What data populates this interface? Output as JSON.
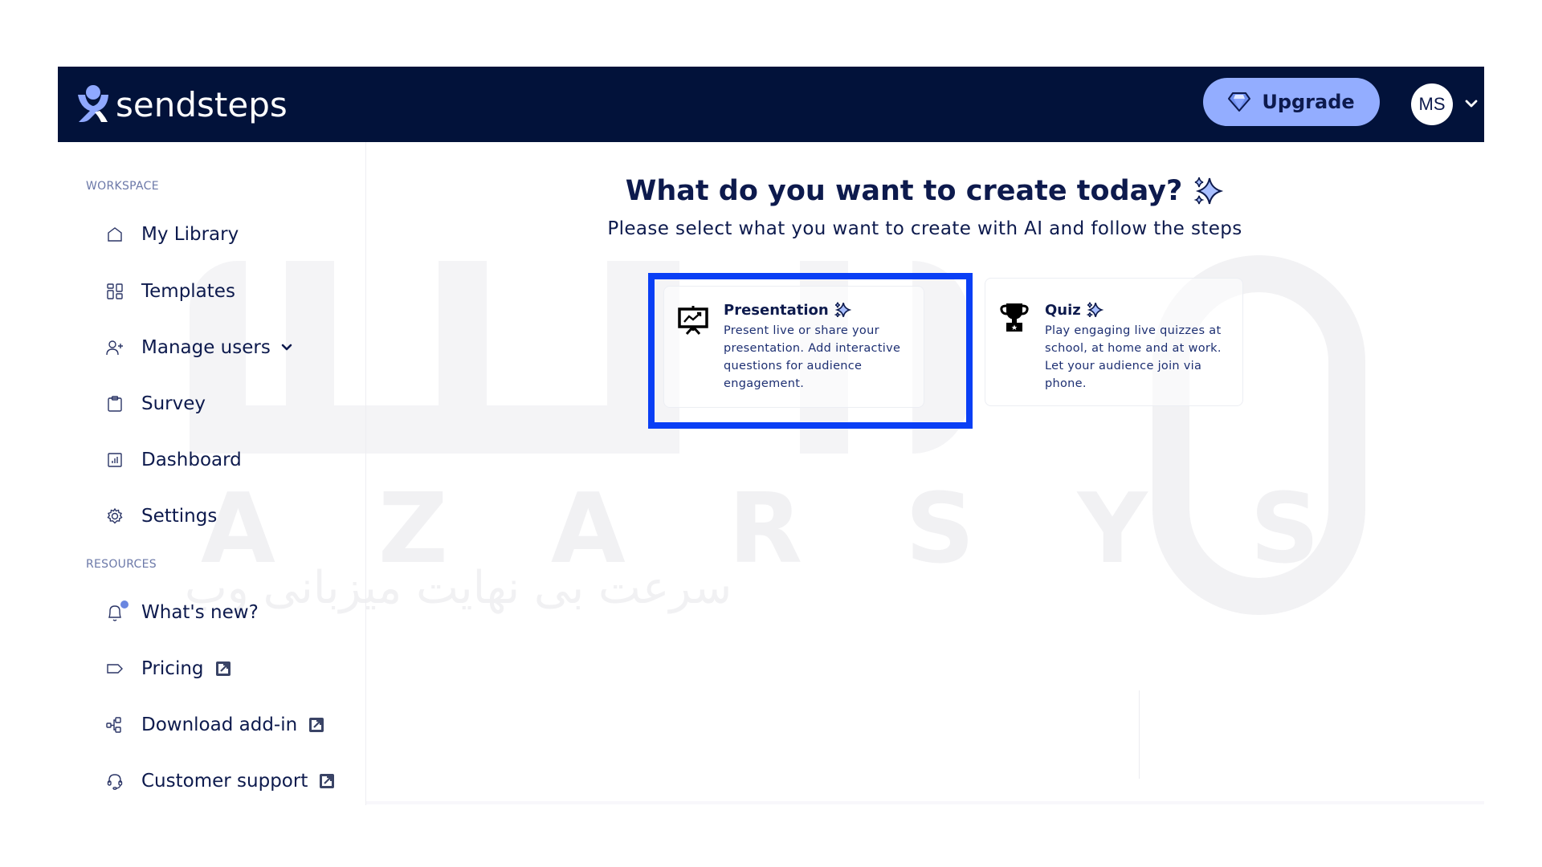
{
  "header": {
    "logo_text": "sendsteps",
    "upgrade_label": "Upgrade",
    "avatar_initials": "MS",
    "colors": {
      "background": "#02123a",
      "upgrade_bg": "#93adff",
      "logo_accent": "#8fa8ff"
    }
  },
  "sidebar": {
    "workspace_label": "WORKSPACE",
    "workspace_items": [
      {
        "label": "My Library",
        "icon": "home-icon"
      },
      {
        "label": "Templates",
        "icon": "grid-icon"
      },
      {
        "label": "Manage users",
        "icon": "add-user-icon",
        "has_dropdown": true
      },
      {
        "label": "Survey",
        "icon": "clipboard-icon"
      },
      {
        "label": "Dashboard",
        "icon": "chart-icon"
      },
      {
        "label": "Settings",
        "icon": "gear-icon"
      }
    ],
    "resources_label": "RESOURCES",
    "resource_items": [
      {
        "label": "What's new?",
        "icon": "bell-icon",
        "notification_dot": true
      },
      {
        "label": "Pricing",
        "icon": "tag-icon",
        "external": true
      },
      {
        "label": "Download add-in",
        "icon": "addin-icon",
        "external": true
      },
      {
        "label": "Customer support",
        "icon": "headset-icon",
        "external": true
      }
    ]
  },
  "main": {
    "title": "What do you want to create today?",
    "subtitle": "Please select what you want to create with AI and follow the steps",
    "cards": [
      {
        "title": "Presentation",
        "description": "Present live or share your presentation. Add interactive questions for audience engagement.",
        "icon": "presentation-board-icon",
        "highlighted": true
      },
      {
        "title": "Quiz",
        "description": "Play engaging live quizzes at school, at home and at work. Let your audience join via phone.",
        "icon": "trophy-icon",
        "highlighted": false
      }
    ],
    "highlight_color": "#0a3ff5"
  },
  "watermark": {
    "letters": "AZARSYS",
    "persian": "سرعت بی نهایت میزبانی وب"
  }
}
